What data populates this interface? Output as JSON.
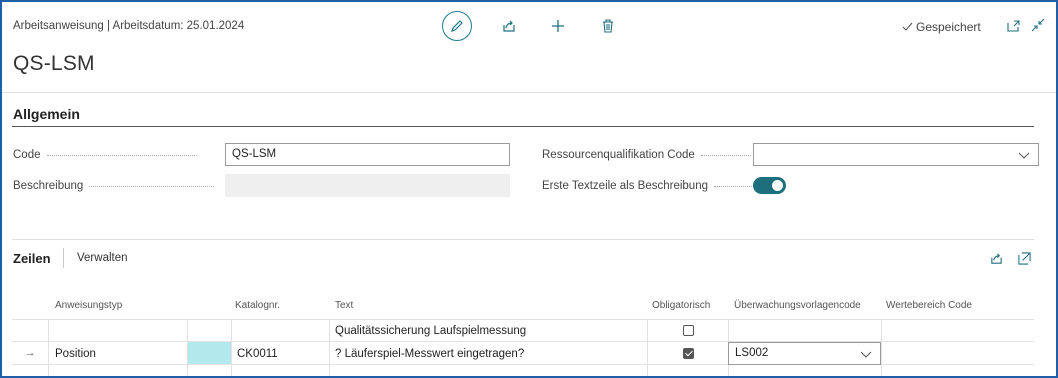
{
  "header": {
    "breadcrumb": "Arbeitsanweisung | Arbeitsdatum: 25.01.2024",
    "title": "QS-LSM",
    "saved_label": "Gespeichert"
  },
  "icons": {
    "edit": "pencil-icon",
    "share": "share-icon",
    "new": "plus-icon",
    "delete": "trash-icon",
    "open_new_window": "open-new-window-icon",
    "collapse": "collapse-icon"
  },
  "general": {
    "section_title": "Allgemein",
    "code_label": "Code",
    "code_value": "QS-LSM",
    "description_label": "Beschreibung",
    "description_value": "",
    "resource_qual_label": "Ressourcenqualifikation Code",
    "resource_qual_value": "",
    "first_line_label": "Erste Textzeile als Beschreibung",
    "first_line_enabled": true
  },
  "lines": {
    "title": "Zeilen",
    "manage_label": "Verwalten",
    "columns": [
      "Anweisungstyp",
      "Katalognr.",
      "Text",
      "Obligatorisch",
      "Überwachungsvorlagencode",
      "Wertebereich Code"
    ],
    "rows": [
      {
        "marker": "",
        "type": "",
        "catalog": "",
        "text": "Qualitätssicherung Laufspielmessung",
        "mandatory": false,
        "template": "",
        "range": ""
      },
      {
        "marker": "→",
        "type": "Position",
        "catalog": "CK0011",
        "text": "? Läuferspiel-Messwert eingetragen?",
        "mandatory": true,
        "template": "LS002",
        "range": ""
      }
    ]
  },
  "colors": {
    "accent": "#1e6f7e",
    "frame": "#1f5fa8",
    "highlight_cell": "#b3e8ec"
  }
}
